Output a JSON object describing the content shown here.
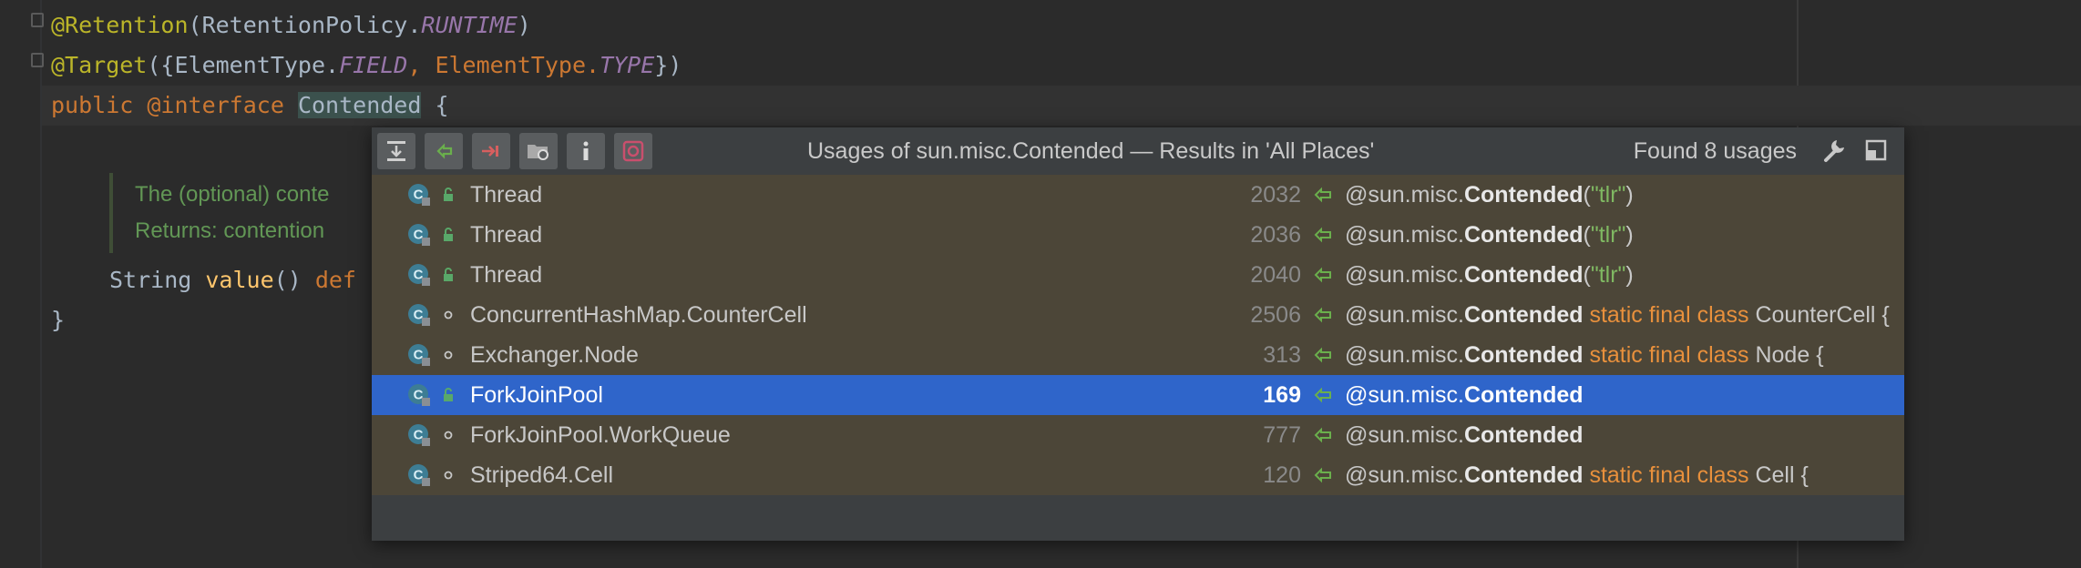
{
  "editor": {
    "lines": {
      "l1_ann": "@Retention",
      "l1_a": "(RetentionPolicy.",
      "l1_b": "RUNTIME",
      "l1_c": ")",
      "l2_ann": "@Target",
      "l2_a": "({ElementType.",
      "l2_b": "FIELD",
      "l2_c": ", ElementType.",
      "l2_d": "TYPE",
      "l2_e": "})",
      "l3_kw": "public",
      "l3_ann": "@interface",
      "l3_cls": "Contended",
      "l3_brace": "{",
      "doc1": "The (optional) conte",
      "doc2": "Returns: contention",
      "l6_type": "String",
      "l6_fn": "value",
      "l6_paren": "()",
      "l6_kw": "def",
      "l7": "}"
    }
  },
  "popup": {
    "title": "Usages of sun.misc.Contended — Results in 'All Places'",
    "found": "Found 8 usages",
    "toolbar_icons": [
      "expand-all-icon",
      "previous-occurrence-icon",
      "next-occurrence-icon",
      "scope-folder-icon",
      "info-icon",
      "settings-icon"
    ],
    "rows": [
      {
        "name": "Thread",
        "line": "2032",
        "pre": "@sun.misc.",
        "bold": "Contended",
        "post_kind": "str",
        "post_a": "(",
        "post_str": "\"tlr\"",
        "post_b": ")",
        "access": "lock",
        "selected": false
      },
      {
        "name": "Thread",
        "line": "2036",
        "pre": "@sun.misc.",
        "bold": "Contended",
        "post_kind": "str",
        "post_a": "(",
        "post_str": "\"tlr\"",
        "post_b": ")",
        "access": "lock",
        "selected": false
      },
      {
        "name": "Thread",
        "line": "2040",
        "pre": "@sun.misc.",
        "bold": "Contended",
        "post_kind": "str",
        "post_a": "(",
        "post_str": "\"tlr\"",
        "post_b": ")",
        "access": "lock",
        "selected": false
      },
      {
        "name": "ConcurrentHashMap.CounterCell",
        "line": "2506",
        "pre": "@sun.misc.",
        "bold": "Contended",
        "post_kind": "kw",
        "post_kw": " static final class",
        "post_rest": " CounterCell {",
        "access": "dot",
        "selected": false
      },
      {
        "name": "Exchanger.Node",
        "line": "313",
        "pre": "@sun.misc.",
        "bold": "Contended",
        "post_kind": "kw",
        "post_kw": " static final class",
        "post_rest": " Node {",
        "access": "dot",
        "selected": false
      },
      {
        "name": "ForkJoinPool",
        "line": "169",
        "pre": "@sun.misc.",
        "bold": "Contended",
        "post_kind": "none",
        "access": "lock",
        "selected": true
      },
      {
        "name": "ForkJoinPool.WorkQueue",
        "line": "777",
        "pre": "@sun.misc.",
        "bold": "Contended",
        "post_kind": "none",
        "access": "dot",
        "selected": false
      },
      {
        "name": "Striped64.Cell",
        "line": "120",
        "pre": "@sun.misc.",
        "bold": "Contended",
        "post_kind": "kw",
        "post_kw": " static final class",
        "post_rest": " Cell {",
        "access": "dot",
        "selected": false
      }
    ]
  },
  "colors": {
    "popup_bg": "#4c4638",
    "selected_row": "#2f65ca",
    "editor_bg": "#2b2b2b",
    "keyword": "#cc7832",
    "annotation": "#bbb529",
    "string": "#7fb862"
  }
}
